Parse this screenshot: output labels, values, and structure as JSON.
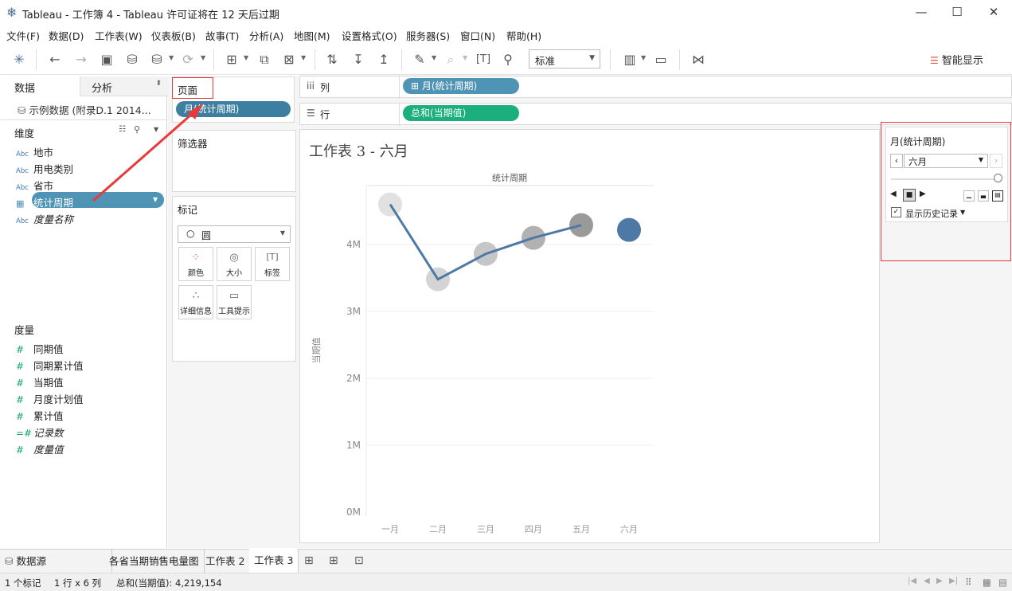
{
  "window": {
    "title": "Tableau - 工作簿 4 - Tableau 许可证将在 12 天后过期",
    "minimize": "—",
    "maximize": "☐",
    "close": "✕"
  },
  "menu": [
    "文件(F)",
    "数据(D)",
    "工作表(W)",
    "仪表板(B)",
    "故事(T)",
    "分析(A)",
    "地图(M)",
    "设置格式(O)",
    "服务器(S)",
    "窗口(N)",
    "帮助(H)"
  ],
  "toolbar": {
    "fit_select": "标准",
    "smart_show": "智能显示"
  },
  "left": {
    "tab_data": "数据",
    "tab_analysis": "分析",
    "datasource": "示例数据 (附录D.1 2014...",
    "dimensions_title": "维度",
    "dimensions": [
      {
        "type": "Abc",
        "name": "地市"
      },
      {
        "type": "Abc",
        "name": "用电类别"
      },
      {
        "type": "Abc",
        "name": "省市"
      },
      {
        "type": "date",
        "name": "统计周期"
      },
      {
        "type": "Abc",
        "name": "度量名称"
      }
    ],
    "measures_title": "度量",
    "measures": [
      "同期值",
      "同期累计值",
      "当期值",
      "月度计划值",
      "累计值",
      "记录数",
      "度量值"
    ]
  },
  "shelves": {
    "pages_title": "页面",
    "pages_pill": "月(统计周期)",
    "filters_title": "筛选器",
    "marks_title": "标记",
    "mark_type": "圆",
    "mark_buttons": [
      "颜色",
      "大小",
      "标签",
      "详细信息",
      "工具提示"
    ],
    "columns_label": "列",
    "columns_pill": "⊞ 月(统计周期)",
    "rows_label": "行",
    "rows_pill": "总和(当期值)"
  },
  "sheet": {
    "title": "工作表 3 - 六月",
    "header": "统计周期",
    "ylabel": "当期值"
  },
  "chart_data": {
    "type": "line",
    "categories": [
      "一月",
      "二月",
      "三月",
      "四月",
      "五月",
      "六月"
    ],
    "values": [
      4600000,
      3480000,
      3860000,
      4100000,
      4290000,
      4219154
    ],
    "yticks": [
      "0M",
      "1M",
      "2M",
      "3M",
      "4M"
    ],
    "ylim": [
      0,
      5000000
    ],
    "colors": {
      "line": "#4e79a7",
      "current": "#4e79a7",
      "history": [
        "#e1e1e1",
        "#d4d4d4",
        "#c6c6c6",
        "#b1b1b1",
        "#9a9a9a"
      ]
    }
  },
  "page_control": {
    "title": "月(统计周期)",
    "value": "六月",
    "show_history": "显示历史记录"
  },
  "tabs": {
    "datasource": "数据源",
    "sheets": [
      "各省当期销售电量图",
      "工作表 2",
      "工作表 3"
    ]
  },
  "status": {
    "marks": "1 个标记",
    "dims": "1 行 x 6 列",
    "sum": "总和(当期值): 4,219,154"
  }
}
